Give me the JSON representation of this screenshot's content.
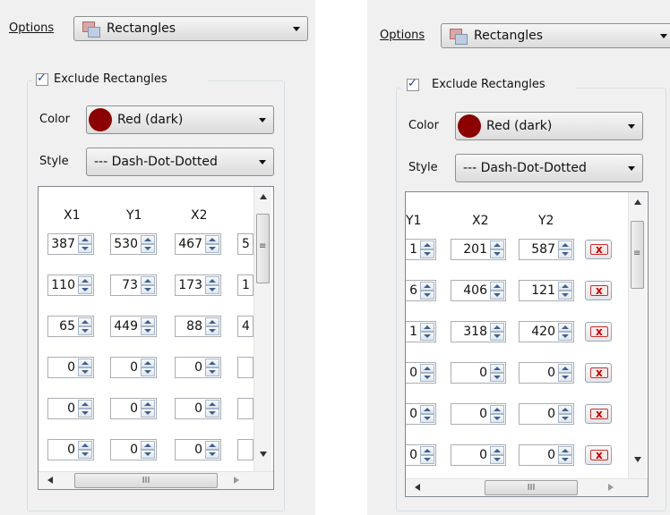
{
  "options_label": "Options",
  "options_value": "Rectangles",
  "exclude_label": "Exclude Rectangles",
  "exclude_checked": true,
  "color_label": "Color",
  "color_value": "Red (dark)",
  "color_swatch": "#8b0000",
  "style_label": "Style",
  "style_value": "--- Dash-Dot-Dotted",
  "left": {
    "headers": [
      "X1",
      "Y1",
      "X2"
    ],
    "rows": [
      [
        "387",
        "530",
        "467"
      ],
      [
        "110",
        "73",
        "173"
      ],
      [
        "65",
        "449",
        "88"
      ],
      [
        "0",
        "0",
        "0"
      ],
      [
        "0",
        "0",
        "0"
      ],
      [
        "0",
        "0",
        "0"
      ]
    ],
    "partial": [
      "5",
      "1",
      "4",
      "",
      "",
      ""
    ]
  },
  "right": {
    "headers": [
      "Y1",
      "X2",
      "Y2"
    ],
    "rows": [
      [
        "1",
        "201",
        "587"
      ],
      [
        "6",
        "406",
        "121"
      ],
      [
        "1",
        "318",
        "420"
      ],
      [
        "0",
        "0",
        "0"
      ],
      [
        "0",
        "0",
        "0"
      ],
      [
        "0",
        "0",
        "0"
      ]
    ],
    "delete_icon": "delete-x-icon"
  }
}
